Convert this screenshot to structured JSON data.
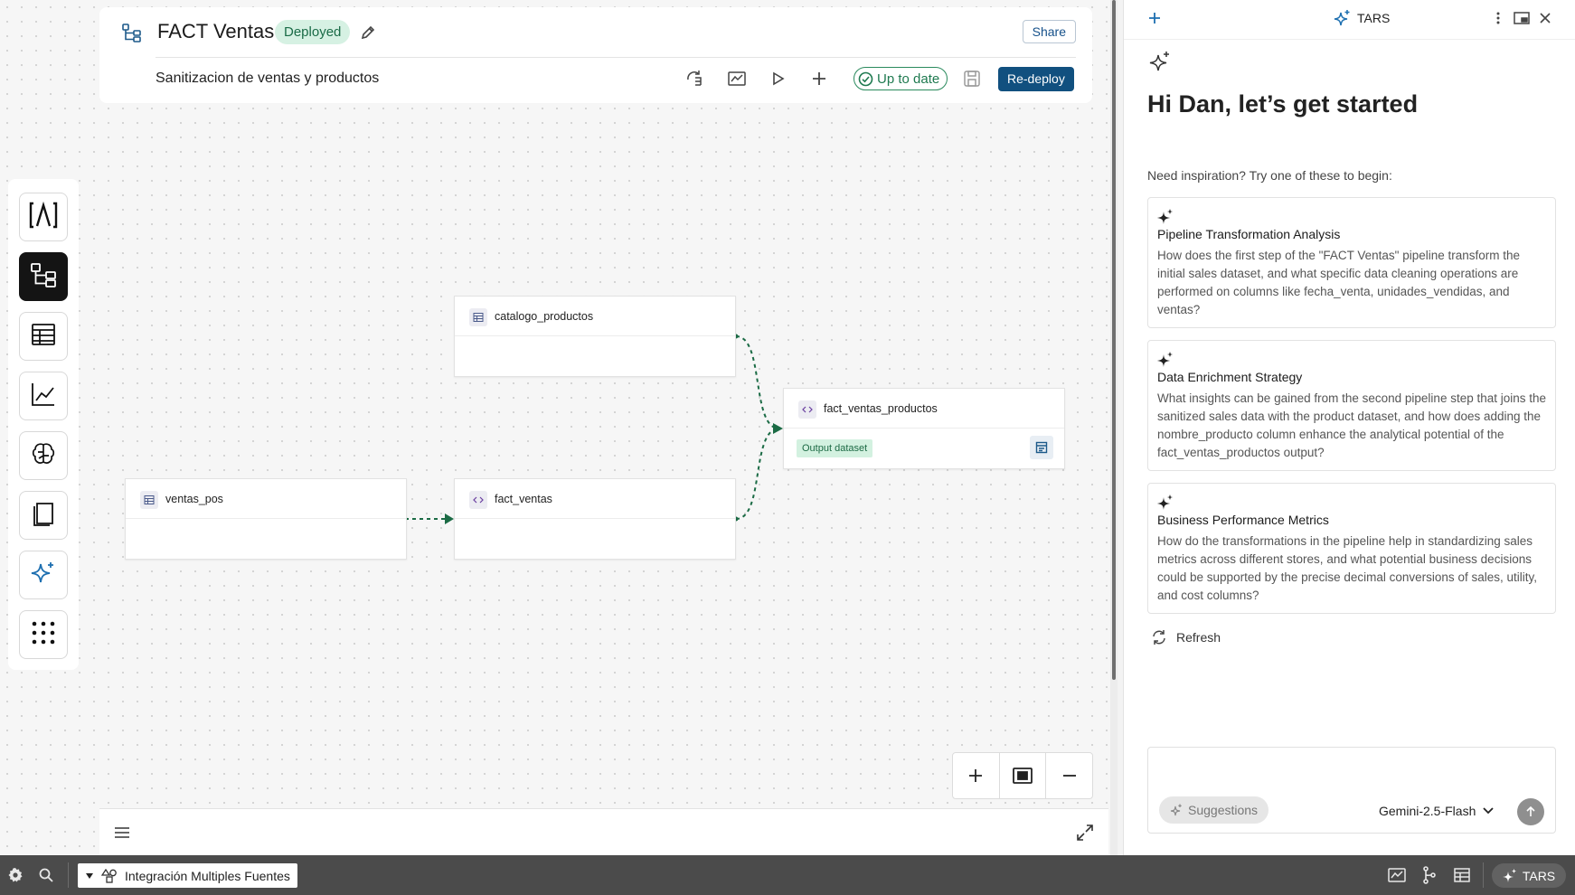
{
  "header": {
    "title": "FACT Ventas",
    "status_badge": "Deployed",
    "share_label": "Share",
    "subtitle": "Sanitizacion de ventas y productos",
    "up_to_date_label": "Up to date",
    "redeploy_label": "Re-deploy"
  },
  "rail": {
    "items": [
      "lambda",
      "pipeline",
      "dataset",
      "chart",
      "model",
      "notebook",
      "assistant",
      "apps"
    ],
    "active": "pipeline"
  },
  "nodes": {
    "catalogo": {
      "label": "catalogo_productos",
      "icon": "table-icon"
    },
    "ventas_pos": {
      "label": "ventas_pos",
      "icon": "table-icon"
    },
    "fact_ventas": {
      "label": "fact_ventas",
      "icon": "code-icon"
    },
    "fact_ventas_productos": {
      "label": "fact_ventas_productos",
      "icon": "code-icon",
      "badge": "Output dataset"
    }
  },
  "colors": {
    "accent": "#11507f",
    "deployed_bg": "#d6f1e3",
    "edge": "#1b6b45",
    "status_bar": "#4b4b4b"
  },
  "assistant": {
    "name": "TARS",
    "greeting": "Hi Dan, let’s get started",
    "inspiration": "Need inspiration? Try one of these to begin:",
    "cards": [
      {
        "title": "Pipeline Transformation Analysis",
        "body": "How does the first step of the \"FACT Ventas\" pipeline transform the initial sales dataset, and what specific data cleaning operations are performed on columns like fecha_venta, unidades_vendidas, and ventas?"
      },
      {
        "title": "Data Enrichment Strategy",
        "body": "What insights can be gained from the second pipeline step that joins the sanitized sales data with the product dataset, and how does adding the nombre_producto column enhance the analytical potential of the fact_ventas_productos output?"
      },
      {
        "title": "Business Performance Metrics",
        "body": "How do the transformations in the pipeline help in standardizing sales metrics across different stores, and what potential business decisions could be supported by the precise decimal conversions of sales, utility, and cost columns?"
      }
    ],
    "refresh_label": "Refresh",
    "suggestions_label": "Suggestions",
    "model": "Gemini-2.5-Flash"
  },
  "statusbar": {
    "tab_label": "Integración Multiples Fuentes",
    "tars_label": "TARS"
  }
}
